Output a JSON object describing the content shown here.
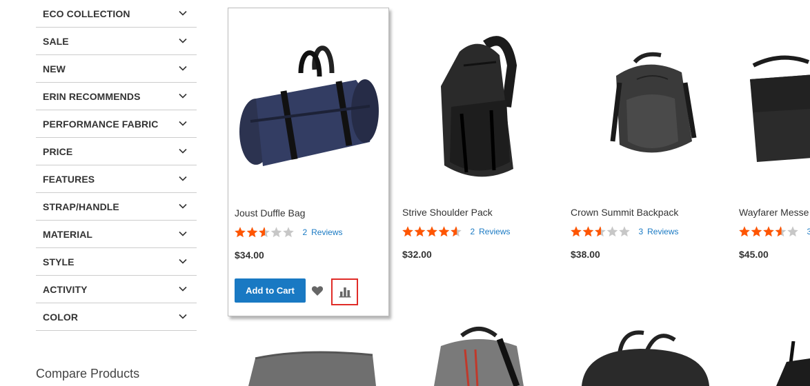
{
  "filters": [
    {
      "label": "ECO COLLECTION"
    },
    {
      "label": "SALE"
    },
    {
      "label": "NEW"
    },
    {
      "label": "ERIN RECOMMENDS"
    },
    {
      "label": "PERFORMANCE FABRIC"
    },
    {
      "label": "PRICE"
    },
    {
      "label": "FEATURES"
    },
    {
      "label": "STRAP/HANDLE"
    },
    {
      "label": "MATERIAL"
    },
    {
      "label": "STYLE"
    },
    {
      "label": "ACTIVITY"
    },
    {
      "label": "COLOR"
    }
  ],
  "compare_section": {
    "title": "Compare Products"
  },
  "products": [
    {
      "name": "Joust Duffle Bag",
      "rating_fraction": 0.5,
      "review_count": "2",
      "reviews_label": "Reviews",
      "price": "$34.00",
      "add_to_cart": "Add to Cart"
    },
    {
      "name": "Strive Shoulder Pack",
      "rating_fraction": 0.9,
      "review_count": "2",
      "reviews_label": "Reviews",
      "price": "$32.00"
    },
    {
      "name": "Crown Summit Backpack",
      "rating_fraction": 0.5,
      "review_count": "3",
      "reviews_label": "Reviews",
      "price": "$38.00"
    },
    {
      "name": "Wayfarer Messe",
      "rating_fraction": 0.7,
      "review_count": "3",
      "reviews_label": "",
      "price": "$45.00"
    }
  ],
  "colors": {
    "accent": "#1979c3",
    "star": "#ff5501",
    "star_empty": "#c7c7c7",
    "highlight": "#e02b27"
  }
}
